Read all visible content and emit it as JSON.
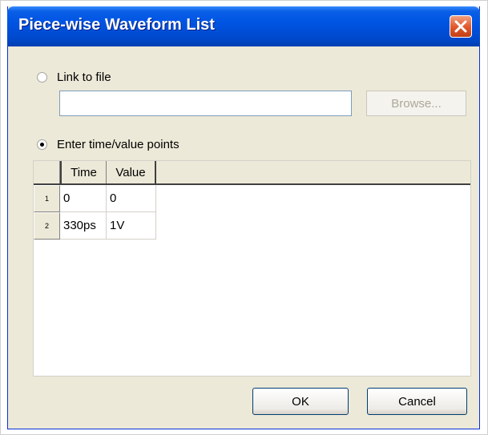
{
  "window": {
    "title": "Piece-wise Waveform List",
    "close_icon": "close-icon"
  },
  "options": {
    "link_to_file": {
      "label": "Link to file",
      "selected": false
    },
    "file_path": {
      "value": "",
      "placeholder": ""
    },
    "browse_label": "Browse...",
    "enter_points": {
      "label": "Enter time/value points",
      "selected": true
    }
  },
  "grid": {
    "columns": [
      "Time",
      "Value"
    ],
    "rows": [
      {
        "index": "1",
        "time": "0",
        "value": "0"
      },
      {
        "index": "2",
        "time": "330ps",
        "value": "1V"
      }
    ]
  },
  "buttons": {
    "ok": "OK",
    "cancel": "Cancel"
  }
}
